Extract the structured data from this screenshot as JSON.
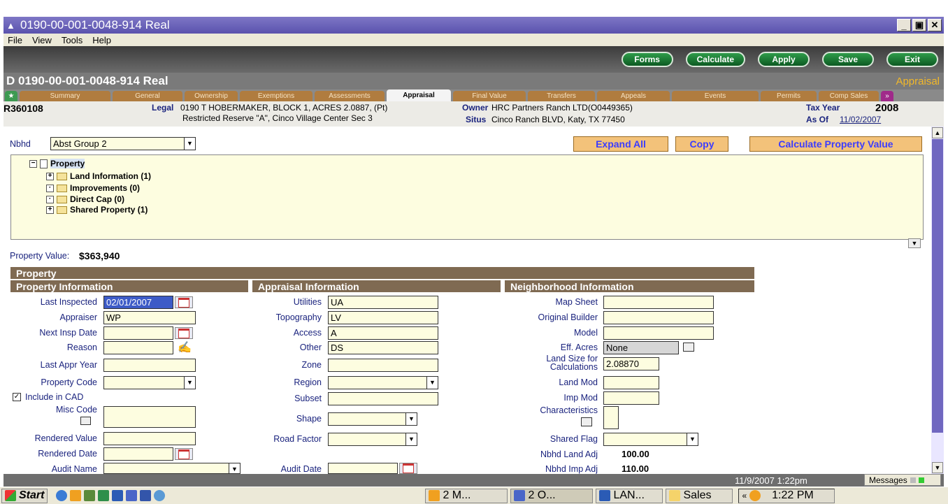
{
  "window": {
    "title": "0190-00-001-0048-914 Real"
  },
  "menu": [
    "File",
    "View",
    "Tools",
    "Help"
  ],
  "toolbar": {
    "forms": "Forms",
    "calculate": "Calculate",
    "apply": "Apply",
    "save": "Save",
    "exit": "Exit"
  },
  "header": {
    "title": "D  0190-00-001-0048-914 Real",
    "section": "Appraisal"
  },
  "tabs": [
    "Summary",
    "General",
    "Ownership",
    "Exemptions",
    "Assessments",
    "Appraisal",
    "Final Value",
    "Transfers",
    "Appeals",
    "Events",
    "Permits",
    "Comp Sales"
  ],
  "info": {
    "account": "R360108",
    "legal_label": "Legal",
    "legal_line1": "0190 T HOBERMAKER, BLOCK 1, ACRES 2.0887, (Pt)",
    "legal_line2": "Restricted Reserve \"A\", Cinco Village Center Sec 3",
    "owner_label": "Owner",
    "owner": "HRC Partners Ranch LTD(O0449365)",
    "situs_label": "Situs",
    "situs": "Cinco Ranch BLVD, Katy, TX 77450",
    "taxyear_label": "Tax Year",
    "taxyear": "2008",
    "asof_label": "As Of",
    "asof": "11/02/2007"
  },
  "nbhd": {
    "label": "Nbhd",
    "value": "Abst Group 2"
  },
  "actions": {
    "expand": "Expand All",
    "copy": "Copy",
    "calc_value": "Calculate Property Value"
  },
  "tree": {
    "root": "Property",
    "children": [
      "Land Information (1)",
      "Improvements (0)",
      "Direct Cap (0)",
      "Shared Property (1)"
    ]
  },
  "property_value": {
    "label": "Property Value:",
    "value": "$363,940"
  },
  "sections": {
    "property": "Property",
    "prop_info": "Property Information",
    "appr_info": "Appraisal Information",
    "nbhd_info": "Neighborhood Information"
  },
  "left": {
    "last_inspected": {
      "label": "Last Inspected",
      "value": "02/01/2007"
    },
    "appraiser": {
      "label": "Appraiser",
      "value": "WP"
    },
    "next_insp": {
      "label": "Next Insp Date",
      "value": ""
    },
    "reason": {
      "label": "Reason",
      "value": ""
    },
    "last_appr_year": {
      "label": "Last Appr Year",
      "value": ""
    },
    "property_code": {
      "label": "Property Code",
      "value": ""
    },
    "include_cad": {
      "label": "Include in CAD",
      "checked": true
    },
    "misc_code": {
      "label": "Misc Code",
      "value": ""
    },
    "rendered_value": {
      "label": "Rendered Value",
      "value": ""
    },
    "rendered_date": {
      "label": "Rendered Date",
      "value": ""
    },
    "audit_name": {
      "label": "Audit Name",
      "value": ""
    }
  },
  "middle": {
    "utilities": {
      "label": "Utilities",
      "value": "UA"
    },
    "topography": {
      "label": "Topography",
      "value": "LV"
    },
    "access": {
      "label": "Access",
      "value": "A"
    },
    "other": {
      "label": "Other",
      "value": "DS"
    },
    "zone": {
      "label": "Zone",
      "value": ""
    },
    "region": {
      "label": "Region",
      "value": ""
    },
    "subset": {
      "label": "Subset",
      "value": ""
    },
    "shape": {
      "label": "Shape",
      "value": ""
    },
    "road_factor": {
      "label": "Road Factor",
      "value": ""
    },
    "audit_date": {
      "label": "Audit Date",
      "value": ""
    }
  },
  "right": {
    "map_sheet": {
      "label": "Map Sheet",
      "value": ""
    },
    "original_builder": {
      "label": "Original Builder",
      "value": ""
    },
    "model": {
      "label": "Model",
      "value": ""
    },
    "eff_acres": {
      "label": "Eff. Acres",
      "value": "None"
    },
    "land_size_l1": "Land Size for",
    "land_size_l2": "Calculations",
    "land_size": "2.08870",
    "land_mod": {
      "label": "Land Mod",
      "value": ""
    },
    "imp_mod": {
      "label": "Imp Mod",
      "value": ""
    },
    "characteristics": {
      "label": "Characteristics",
      "value": ""
    },
    "shared_flag": {
      "label": "Shared Flag",
      "value": ""
    },
    "nbhd_land_adj": {
      "label": "Nbhd Land Adj",
      "value": "100.00"
    },
    "nbhd_imp_adj": {
      "label": "Nbhd Imp Adj",
      "value": "110.00"
    }
  },
  "status": {
    "datetime": "11/9/2007 1:22pm",
    "messages": "Messages"
  },
  "taskbar": {
    "start": "Start",
    "items": [
      "2 M...",
      "2 O...",
      "LAN...",
      "Sales"
    ],
    "clock": "1:22 PM"
  }
}
